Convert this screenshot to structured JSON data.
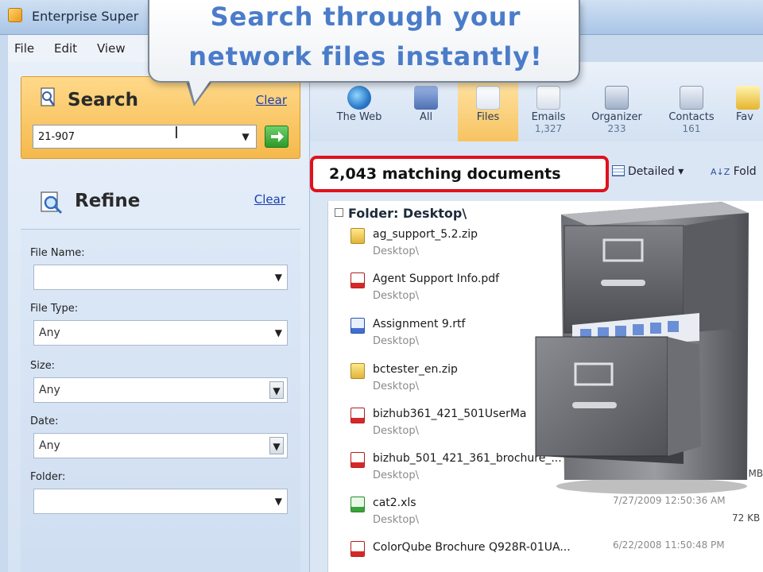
{
  "window": {
    "title": "Enterprise Super"
  },
  "menu": {
    "items": [
      "File",
      "Edit",
      "View"
    ]
  },
  "callout": {
    "line1": "Search through your",
    "line2": "network files instantly!"
  },
  "search": {
    "heading": "Search",
    "clear": "Clear",
    "query": "21-907"
  },
  "refine": {
    "heading": "Refine",
    "clear": "Clear",
    "fields": [
      {
        "label": "File Name:",
        "value": ""
      },
      {
        "label": "File Type:",
        "value": "Any"
      },
      {
        "label": "Size:",
        "value": "Any"
      },
      {
        "label": "Date:",
        "value": "Any"
      },
      {
        "label": "Folder:",
        "value": ""
      }
    ]
  },
  "toolbar": {
    "buttons": [
      {
        "label": "The Web",
        "count": ""
      },
      {
        "label": "All",
        "count": ""
      },
      {
        "label": "Files",
        "count": ""
      },
      {
        "label": "Emails",
        "count": "1,327"
      },
      {
        "label": "Organizer",
        "count": "233"
      },
      {
        "label": "Contacts",
        "count": "161"
      },
      {
        "label": "Fav",
        "count": ""
      }
    ]
  },
  "results": {
    "match_count": "2,043 matching documents",
    "view_mode": "Detailed",
    "sort_label": "Fold",
    "folder_group": "Folder: Desktop\\",
    "rows": [
      {
        "name": "ag_support_5.2.zip",
        "path": "Desktop\\",
        "date": "",
        "size": ""
      },
      {
        "name": "Agent Support Info.pdf",
        "path": "Desktop\\",
        "date": "",
        "size": ""
      },
      {
        "name": "Assignment 9.rtf",
        "path": "Desktop\\",
        "date": "",
        "size": ""
      },
      {
        "name": "bctester_en.zip",
        "path": "Desktop\\",
        "date": "",
        "size": ""
      },
      {
        "name": "bizhub361_421_501UserMa",
        "path": "Desktop\\",
        "date": "",
        "size": ""
      },
      {
        "name": "bizhub_501_421_361_brochure_...",
        "path": "Desktop\\",
        "date": "",
        "size": "5.14 MB"
      },
      {
        "name": "cat2.xls",
        "path": "Desktop\\",
        "date": "7/27/2009 12:50:36 AM",
        "size": "72 KB"
      },
      {
        "name": "ColorQube Brochure Q928R-01UA...",
        "path": "",
        "date": "6/22/2008 11:50:48 PM",
        "size": ""
      }
    ]
  },
  "colors": {
    "accent_orange": "#f5b94c",
    "highlight_red": "#e0121c",
    "callout_blue": "#4a7cc9"
  }
}
